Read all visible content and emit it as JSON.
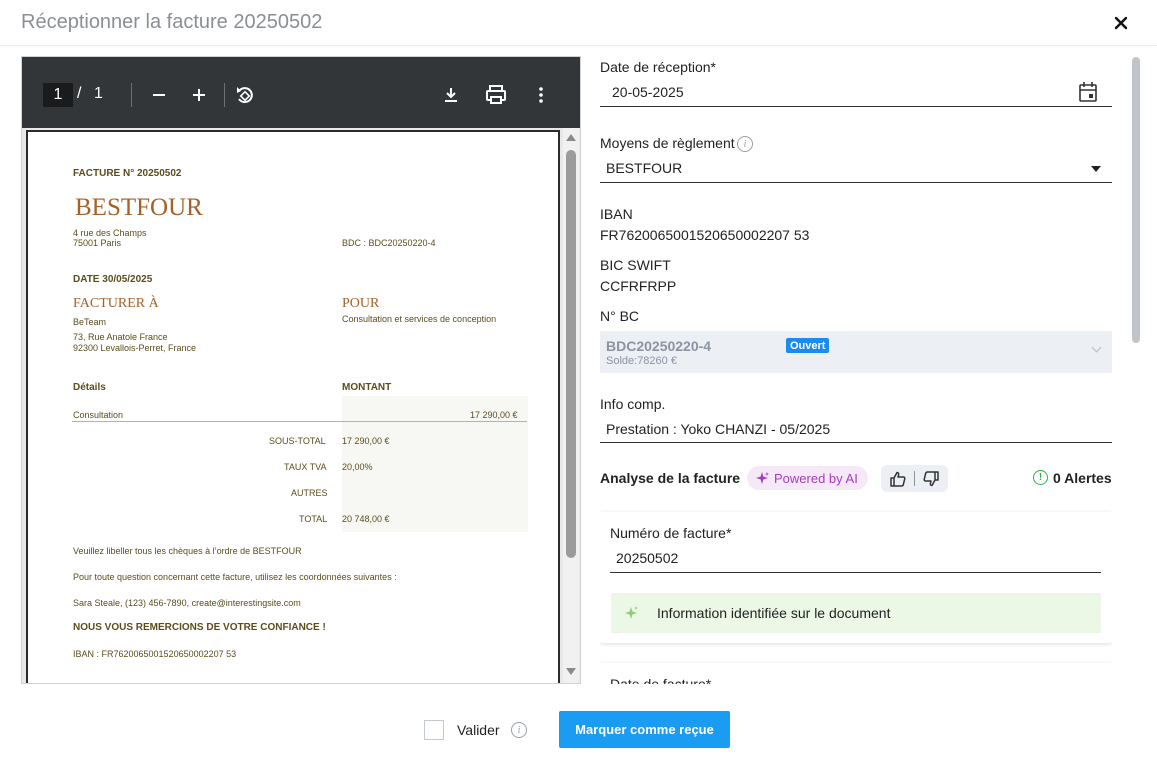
{
  "modal": {
    "title": "Réceptionner la facture 20250502"
  },
  "pdf_toolbar": {
    "current_page": "1",
    "separator": "/",
    "total_pages": "1"
  },
  "invoice_document": {
    "facture_number": "FACTURE N° 20250502",
    "company_name": "BESTFOUR",
    "company_street": "4 rue des Champs",
    "company_city": "75001 Paris",
    "bdc_ref": "BDC : BDC20250220-4",
    "date": "DATE 30/05/2025",
    "bill_to_heading": "FACTURER À",
    "bill_to_name": "BeTeam",
    "bill_to_street": "73, Rue Anatole France",
    "bill_to_city": "92300 Levallois-Perret, France",
    "for_heading": "POUR",
    "for_text": "Consultation et services de conception",
    "details_header": "Détails",
    "amount_header": "MONTANT",
    "line_item": "Consultation",
    "line_amount": "17 290,00 €",
    "subtotal_label": "SOUS-TOTAL",
    "subtotal_value": "17 290,00 €",
    "tva_label": "TAUX TVA",
    "tva_value": "20,00%",
    "other_label": "AUTRES",
    "total_label": "TOTAL",
    "total_value": "20 748,00 €",
    "cheque_note": "Veuillez libeller tous les chèques à l’ordre de BESTFOUR",
    "question_note": "Pour toute question concernant cette facture, utilisez les coordonnées suivantes :",
    "contact": "Sara Steale, (123) 456-7890, create@interestingsite.com",
    "thanks": "NOUS VOUS REMERCIONS DE VOTRE CONFIANCE !",
    "iban": "IBAN : FR7620065001520650002207 53"
  },
  "form": {
    "date_reception_label": "Date de réception*",
    "date_reception_value": "20-05-2025",
    "payment_label": "Moyens de règlement",
    "payment_value": "BESTFOUR",
    "iban_label": "IBAN",
    "iban_value": "FR7620065001520650002207 53",
    "bic_label": "BIC SWIFT",
    "bic_value": "CCFRFRPP",
    "bc_label": "N° BC",
    "bc_number": "BDC20250220-4",
    "bc_solde": "Solde:78260 €",
    "bc_status": "Ouvert",
    "info_label": "Info comp.",
    "info_value": "Prestation : Yoko CHANZI - 05/2025"
  },
  "analysis": {
    "title": "Analyse de la facture",
    "ai_badge": "Powered by AI",
    "alerts": "0 Alertes",
    "invoice_number_label": "Numéro de facture*",
    "invoice_number_value": "20250502",
    "ai_info_text": "Information identifiée sur le document",
    "invoice_date_label": "Date de facture*"
  },
  "footer": {
    "validate_label": "Valider",
    "mark_received_button": "Marquer comme reçue"
  },
  "colors": {
    "primary": "#1b9cf3",
    "badge_blue": "#1a8cf0",
    "ai_purple": "#a63bc0",
    "success_green": "#2fb344",
    "pdf_toolbar": "#323639"
  }
}
